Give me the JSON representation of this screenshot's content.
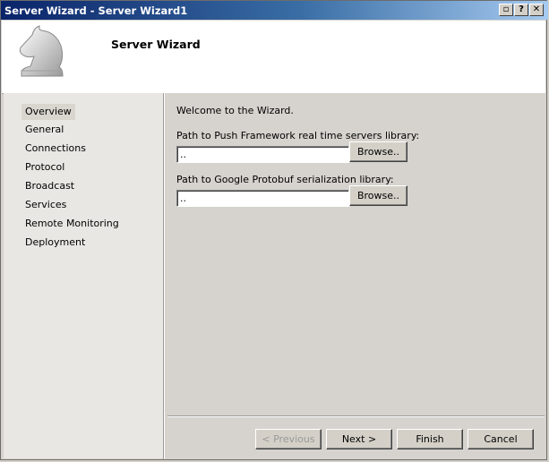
{
  "window": {
    "title": "Server Wizard - Server Wizard1"
  },
  "titlebar_buttons": {
    "restore": "▫",
    "help": "?",
    "close": "✕"
  },
  "header": {
    "title": "Server Wizard",
    "logo_icon": "chess-knight-icon"
  },
  "sidebar": {
    "items": [
      {
        "label": "Overview",
        "selected": true
      },
      {
        "label": "General"
      },
      {
        "label": "Connections"
      },
      {
        "label": "Protocol"
      },
      {
        "label": "Broadcast"
      },
      {
        "label": "Services"
      },
      {
        "label": "Remote Monitoring"
      },
      {
        "label": "Deployment"
      }
    ]
  },
  "main": {
    "welcome": "Welcome to the Wizard.",
    "push_framework": {
      "label": "Path to Push Framework real time servers library:",
      "value": "..",
      "browse_label": "Browse.."
    },
    "protobuf": {
      "label": "Path to Google Protobuf serialization library:",
      "value": "..",
      "browse_label": "Browse.."
    }
  },
  "footer": {
    "previous": "< Previous",
    "next": "Next >",
    "finish": "Finish",
    "cancel": "Cancel"
  }
}
